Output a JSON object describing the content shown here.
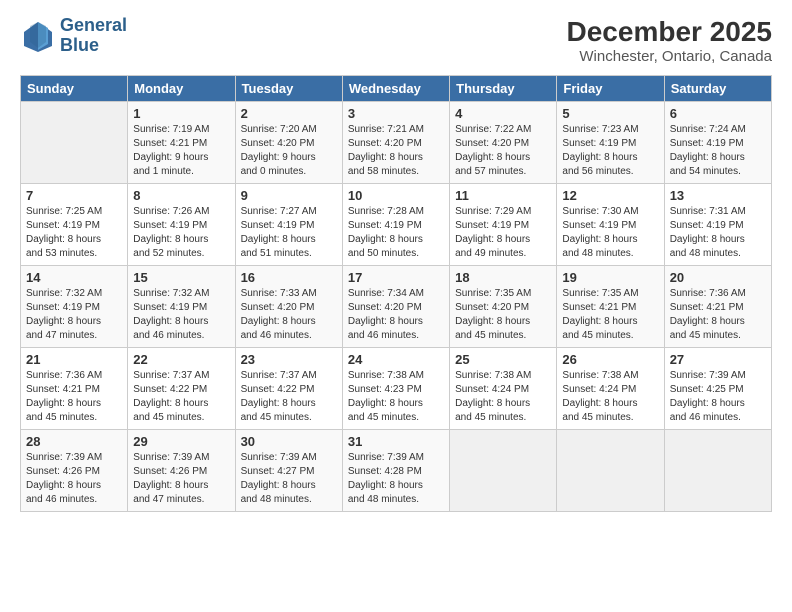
{
  "logo": {
    "line1": "General",
    "line2": "Blue"
  },
  "title": "December 2025",
  "location": "Winchester, Ontario, Canada",
  "weekdays": [
    "Sunday",
    "Monday",
    "Tuesday",
    "Wednesday",
    "Thursday",
    "Friday",
    "Saturday"
  ],
  "weeks": [
    [
      {
        "day": "",
        "info": ""
      },
      {
        "day": "1",
        "info": "Sunrise: 7:19 AM\nSunset: 4:21 PM\nDaylight: 9 hours\nand 1 minute."
      },
      {
        "day": "2",
        "info": "Sunrise: 7:20 AM\nSunset: 4:20 PM\nDaylight: 9 hours\nand 0 minutes."
      },
      {
        "day": "3",
        "info": "Sunrise: 7:21 AM\nSunset: 4:20 PM\nDaylight: 8 hours\nand 58 minutes."
      },
      {
        "day": "4",
        "info": "Sunrise: 7:22 AM\nSunset: 4:20 PM\nDaylight: 8 hours\nand 57 minutes."
      },
      {
        "day": "5",
        "info": "Sunrise: 7:23 AM\nSunset: 4:19 PM\nDaylight: 8 hours\nand 56 minutes."
      },
      {
        "day": "6",
        "info": "Sunrise: 7:24 AM\nSunset: 4:19 PM\nDaylight: 8 hours\nand 54 minutes."
      }
    ],
    [
      {
        "day": "7",
        "info": "Sunrise: 7:25 AM\nSunset: 4:19 PM\nDaylight: 8 hours\nand 53 minutes."
      },
      {
        "day": "8",
        "info": "Sunrise: 7:26 AM\nSunset: 4:19 PM\nDaylight: 8 hours\nand 52 minutes."
      },
      {
        "day": "9",
        "info": "Sunrise: 7:27 AM\nSunset: 4:19 PM\nDaylight: 8 hours\nand 51 minutes."
      },
      {
        "day": "10",
        "info": "Sunrise: 7:28 AM\nSunset: 4:19 PM\nDaylight: 8 hours\nand 50 minutes."
      },
      {
        "day": "11",
        "info": "Sunrise: 7:29 AM\nSunset: 4:19 PM\nDaylight: 8 hours\nand 49 minutes."
      },
      {
        "day": "12",
        "info": "Sunrise: 7:30 AM\nSunset: 4:19 PM\nDaylight: 8 hours\nand 48 minutes."
      },
      {
        "day": "13",
        "info": "Sunrise: 7:31 AM\nSunset: 4:19 PM\nDaylight: 8 hours\nand 48 minutes."
      }
    ],
    [
      {
        "day": "14",
        "info": "Sunrise: 7:32 AM\nSunset: 4:19 PM\nDaylight: 8 hours\nand 47 minutes."
      },
      {
        "day": "15",
        "info": "Sunrise: 7:32 AM\nSunset: 4:19 PM\nDaylight: 8 hours\nand 46 minutes."
      },
      {
        "day": "16",
        "info": "Sunrise: 7:33 AM\nSunset: 4:20 PM\nDaylight: 8 hours\nand 46 minutes."
      },
      {
        "day": "17",
        "info": "Sunrise: 7:34 AM\nSunset: 4:20 PM\nDaylight: 8 hours\nand 46 minutes."
      },
      {
        "day": "18",
        "info": "Sunrise: 7:35 AM\nSunset: 4:20 PM\nDaylight: 8 hours\nand 45 minutes."
      },
      {
        "day": "19",
        "info": "Sunrise: 7:35 AM\nSunset: 4:21 PM\nDaylight: 8 hours\nand 45 minutes."
      },
      {
        "day": "20",
        "info": "Sunrise: 7:36 AM\nSunset: 4:21 PM\nDaylight: 8 hours\nand 45 minutes."
      }
    ],
    [
      {
        "day": "21",
        "info": "Sunrise: 7:36 AM\nSunset: 4:21 PM\nDaylight: 8 hours\nand 45 minutes."
      },
      {
        "day": "22",
        "info": "Sunrise: 7:37 AM\nSunset: 4:22 PM\nDaylight: 8 hours\nand 45 minutes."
      },
      {
        "day": "23",
        "info": "Sunrise: 7:37 AM\nSunset: 4:22 PM\nDaylight: 8 hours\nand 45 minutes."
      },
      {
        "day": "24",
        "info": "Sunrise: 7:38 AM\nSunset: 4:23 PM\nDaylight: 8 hours\nand 45 minutes."
      },
      {
        "day": "25",
        "info": "Sunrise: 7:38 AM\nSunset: 4:24 PM\nDaylight: 8 hours\nand 45 minutes."
      },
      {
        "day": "26",
        "info": "Sunrise: 7:38 AM\nSunset: 4:24 PM\nDaylight: 8 hours\nand 45 minutes."
      },
      {
        "day": "27",
        "info": "Sunrise: 7:39 AM\nSunset: 4:25 PM\nDaylight: 8 hours\nand 46 minutes."
      }
    ],
    [
      {
        "day": "28",
        "info": "Sunrise: 7:39 AM\nSunset: 4:26 PM\nDaylight: 8 hours\nand 46 minutes."
      },
      {
        "day": "29",
        "info": "Sunrise: 7:39 AM\nSunset: 4:26 PM\nDaylight: 8 hours\nand 47 minutes."
      },
      {
        "day": "30",
        "info": "Sunrise: 7:39 AM\nSunset: 4:27 PM\nDaylight: 8 hours\nand 48 minutes."
      },
      {
        "day": "31",
        "info": "Sunrise: 7:39 AM\nSunset: 4:28 PM\nDaylight: 8 hours\nand 48 minutes."
      },
      {
        "day": "",
        "info": ""
      },
      {
        "day": "",
        "info": ""
      },
      {
        "day": "",
        "info": ""
      }
    ]
  ]
}
